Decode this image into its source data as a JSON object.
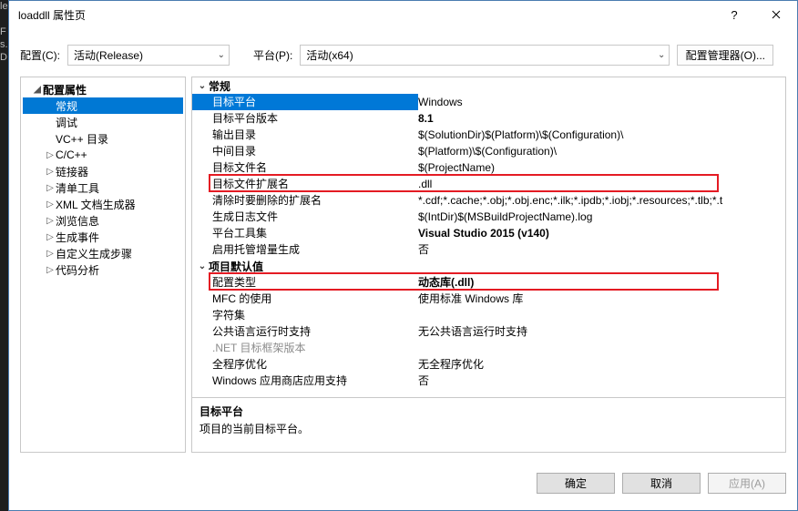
{
  "window": {
    "title": "loaddll 属性页"
  },
  "toolbar": {
    "config_label": "配置(C):",
    "config_value": "活动(Release)",
    "platform_label": "平台(P):",
    "platform_value": "活动(x64)",
    "config_mgr": "配置管理器(O)..."
  },
  "tree": {
    "root": "配置属性",
    "items": [
      {
        "label": "常规",
        "selected": true
      },
      {
        "label": "调试"
      },
      {
        "label": "VC++ 目录"
      },
      {
        "label": "C/C++",
        "expandable": true
      },
      {
        "label": "链接器",
        "expandable": true
      },
      {
        "label": "清单工具",
        "expandable": true
      },
      {
        "label": "XML 文档生成器",
        "expandable": true
      },
      {
        "label": "浏览信息",
        "expandable": true
      },
      {
        "label": "生成事件",
        "expandable": true
      },
      {
        "label": "自定义生成步骤",
        "expandable": true
      },
      {
        "label": "代码分析",
        "expandable": true
      }
    ]
  },
  "groups": [
    {
      "name": "常规",
      "rows": [
        {
          "name": "目标平台",
          "value": "Windows",
          "selected": true
        },
        {
          "name": "目标平台版本",
          "value": "8.1",
          "bold": true
        },
        {
          "name": "输出目录",
          "value": "$(SolutionDir)$(Platform)\\$(Configuration)\\"
        },
        {
          "name": "中间目录",
          "value": "$(Platform)\\$(Configuration)\\"
        },
        {
          "name": "目标文件名",
          "value": "$(ProjectName)"
        },
        {
          "name": "目标文件扩展名",
          "value": ".dll",
          "highlight": true
        },
        {
          "name": "清除时要删除的扩展名",
          "value": "*.cdf;*.cache;*.obj;*.obj.enc;*.ilk;*.ipdb;*.iobj;*.resources;*.tlb;*.t"
        },
        {
          "name": "生成日志文件",
          "value": "$(IntDir)$(MSBuildProjectName).log"
        },
        {
          "name": "平台工具集",
          "value": "Visual Studio 2015 (v140)",
          "bold": true
        },
        {
          "name": "启用托管增量生成",
          "value": "否"
        }
      ]
    },
    {
      "name": "项目默认值",
      "rows": [
        {
          "name": "配置类型",
          "value": "动态库(.dll)",
          "bold": true,
          "highlight": true
        },
        {
          "name": "MFC 的使用",
          "value": "使用标准 Windows 库"
        },
        {
          "name": "字符集",
          "value": ""
        },
        {
          "name": "公共语言运行时支持",
          "value": "无公共语言运行时支持"
        },
        {
          "name": ".NET 目标框架版本",
          "value": "",
          "disabled": true
        },
        {
          "name": "全程序优化",
          "value": "无全程序优化"
        },
        {
          "name": "Windows 应用商店应用支持",
          "value": "否"
        }
      ]
    }
  ],
  "desc": {
    "heading": "目标平台",
    "body": "项目的当前目标平台。"
  },
  "footer": {
    "ok": "确定",
    "cancel": "取消",
    "apply": "应用(A)"
  }
}
